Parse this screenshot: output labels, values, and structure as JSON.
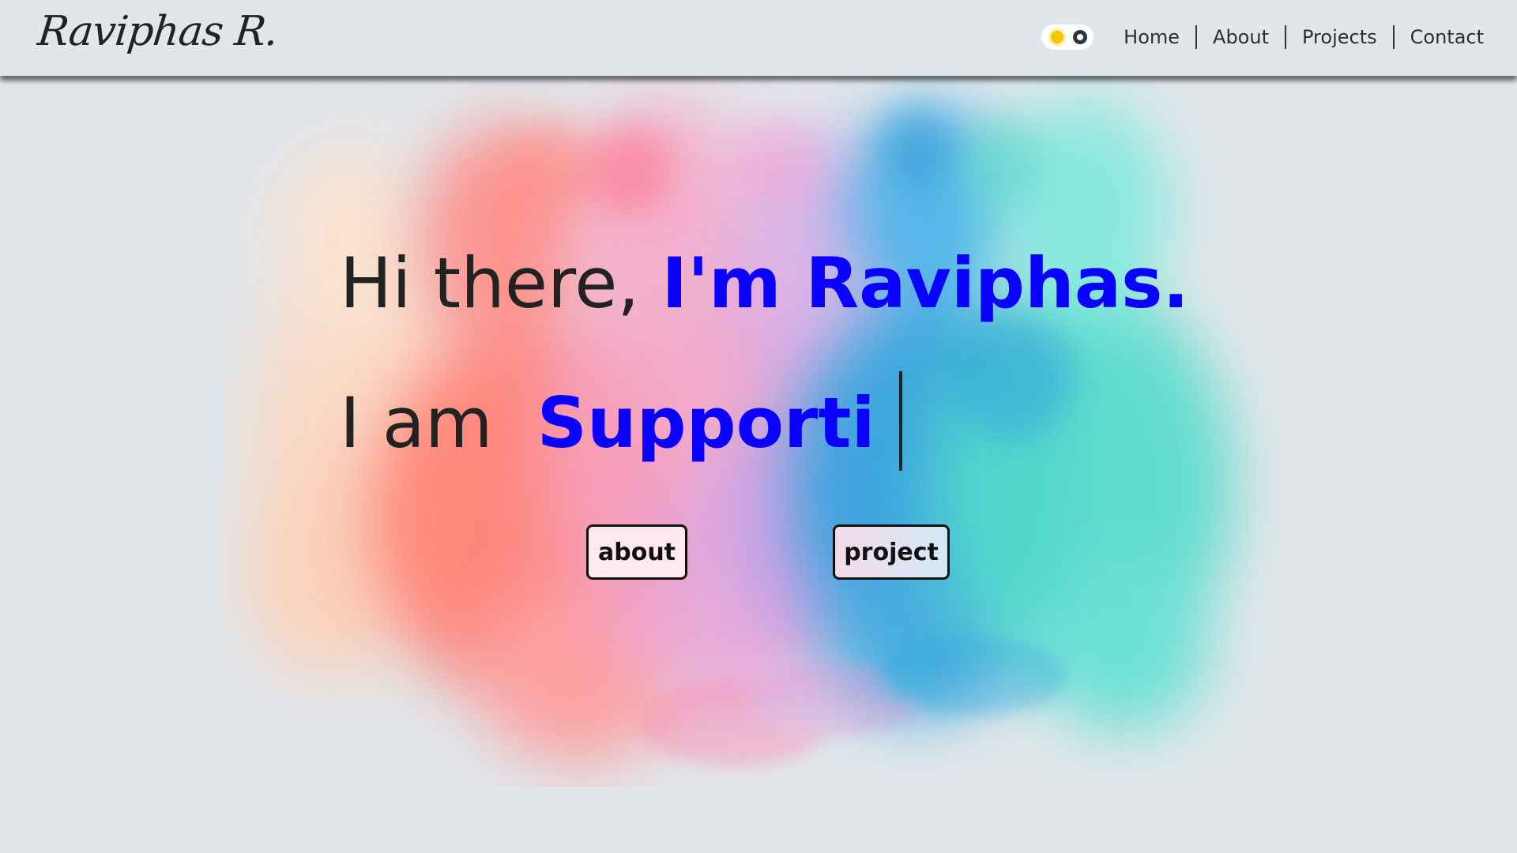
{
  "header": {
    "logo": "Raviphas R.",
    "theme_toggle": {
      "sun_icon": "sun-icon",
      "knob_icon": "toggle-knob-icon"
    },
    "nav": [
      {
        "label": "Home"
      },
      {
        "label": "About"
      },
      {
        "label": "Projects"
      },
      {
        "label": "Contact"
      }
    ]
  },
  "hero": {
    "greeting_prefix": "Hi there,",
    "greeting_name": "I'm Raviphas.",
    "role_prefix": "I am",
    "role_typed": "Supporti",
    "buttons": {
      "about": "about",
      "project": "project"
    },
    "accent_color": "#0a00ff",
    "background_art": "colorful-ink-smoke-illustration"
  }
}
